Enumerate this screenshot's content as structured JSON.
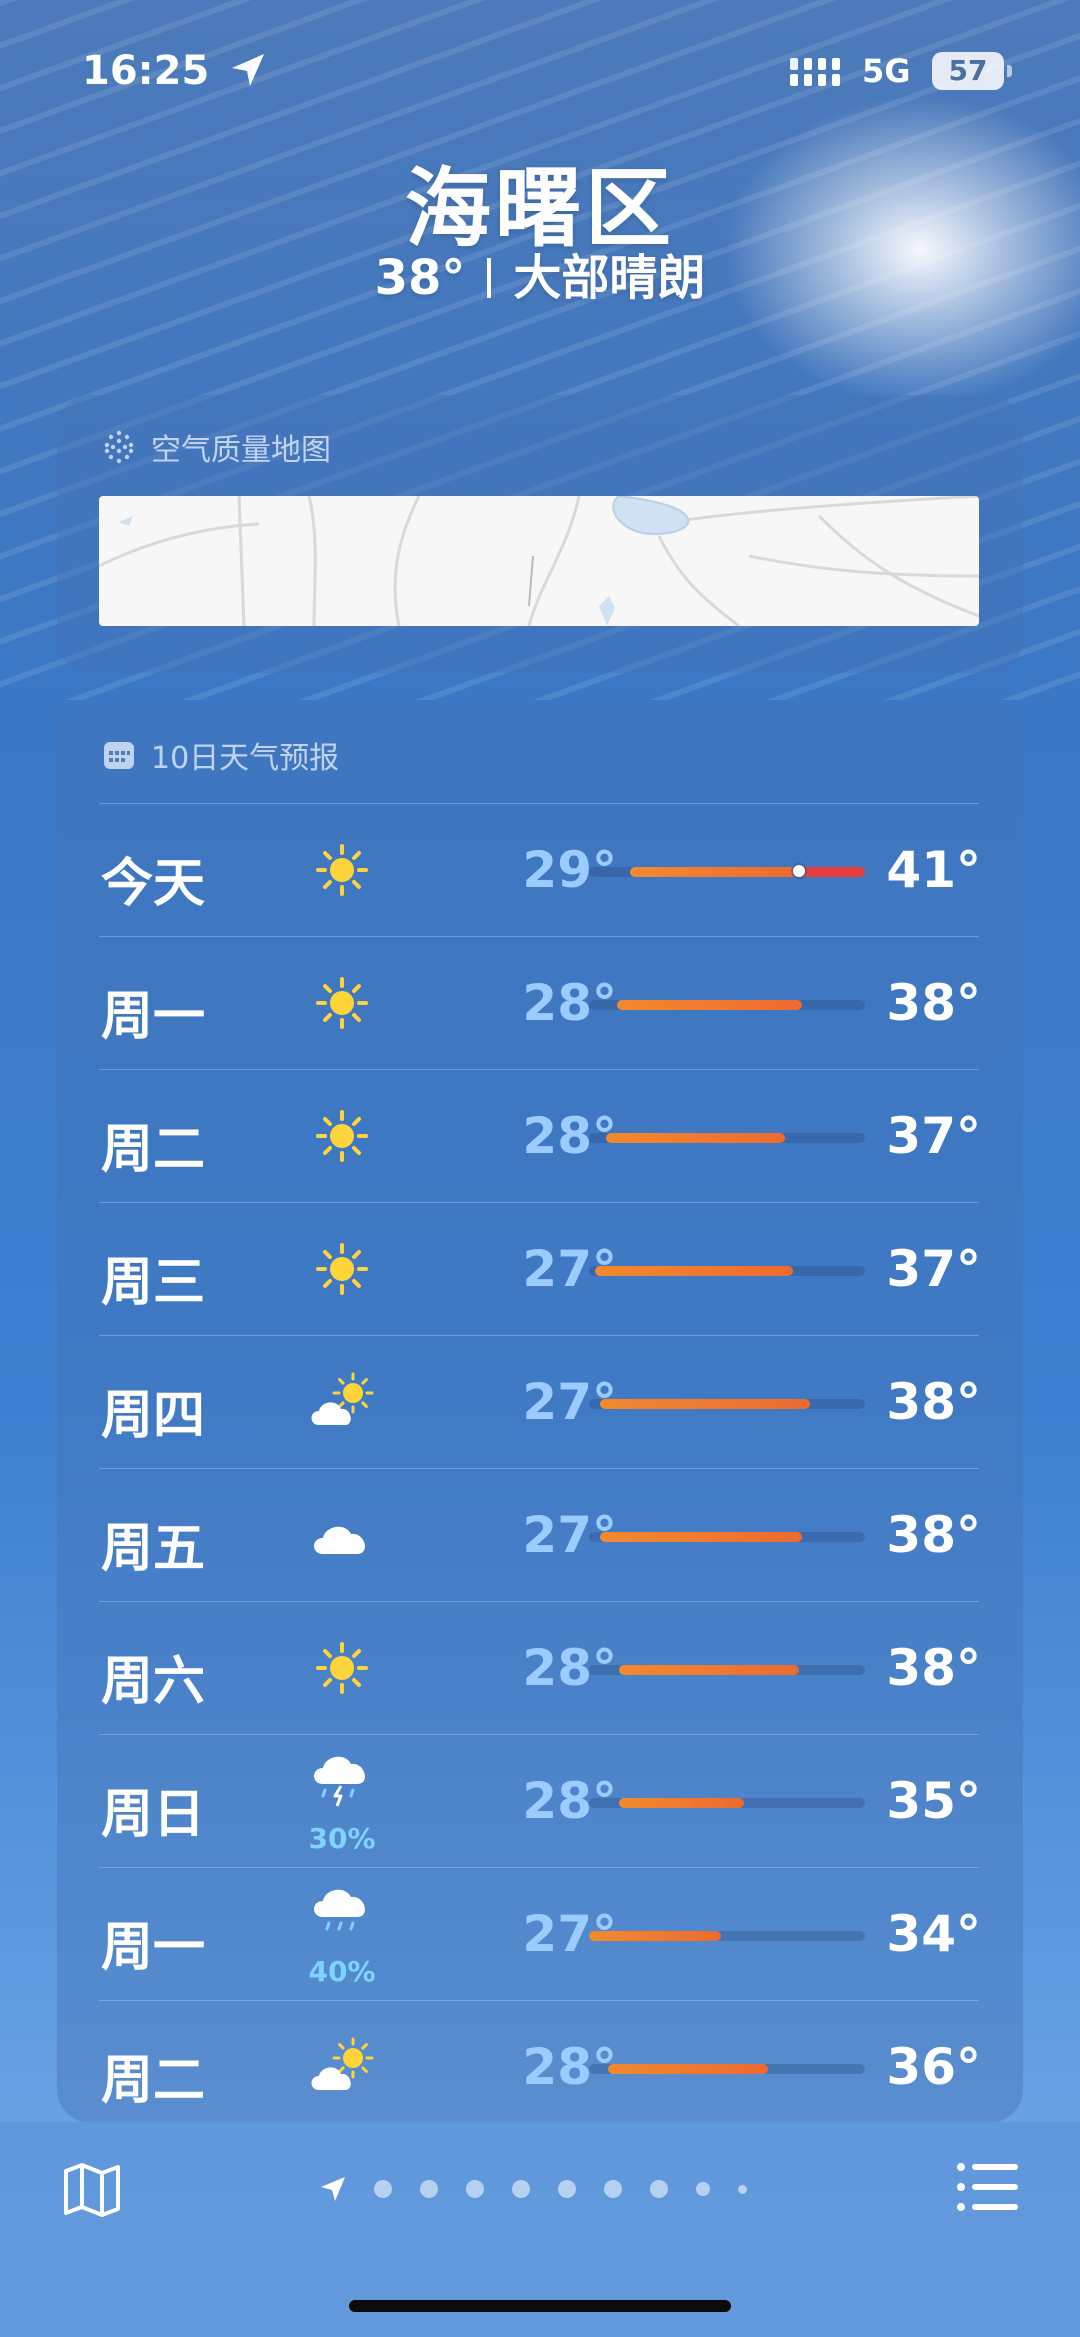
{
  "status_bar": {
    "time": "16:25",
    "network": "5G",
    "battery": "57"
  },
  "location": {
    "city": "海曙区",
    "temperature": "38°",
    "condition": "大部晴朗"
  },
  "air_quality": {
    "title": "空气质量地图",
    "icon": "air-quality-dots-icon"
  },
  "forecast": {
    "title": "10日天气预报",
    "icon": "calendar-icon",
    "days": [
      {
        "day": "今天",
        "icon": "sun-icon",
        "low": "29°",
        "high": "41°",
        "range": [
          0.15,
          1.0
        ],
        "current": 0.76,
        "precip": ""
      },
      {
        "day": "周一",
        "icon": "sun-icon",
        "low": "28°",
        "high": "38°",
        "range": [
          0.1,
          0.77
        ],
        "precip": ""
      },
      {
        "day": "周二",
        "icon": "sun-icon",
        "low": "28°",
        "high": "37°",
        "range": [
          0.06,
          0.71
        ],
        "precip": ""
      },
      {
        "day": "周三",
        "icon": "sun-icon",
        "low": "27°",
        "high": "37°",
        "range": [
          0.02,
          0.74
        ],
        "precip": ""
      },
      {
        "day": "周四",
        "icon": "partly-cloudy-icon",
        "low": "27°",
        "high": "38°",
        "range": [
          0.04,
          0.8
        ],
        "precip": ""
      },
      {
        "day": "周五",
        "icon": "cloud-icon",
        "low": "27°",
        "high": "38°",
        "range": [
          0.04,
          0.77
        ],
        "precip": ""
      },
      {
        "day": "周六",
        "icon": "sun-icon",
        "low": "28°",
        "high": "38°",
        "range": [
          0.11,
          0.76
        ],
        "precip": ""
      },
      {
        "day": "周日",
        "icon": "thunderstorm-icon",
        "low": "28°",
        "high": "35°",
        "range": [
          0.11,
          0.56
        ],
        "precip": "30%"
      },
      {
        "day": "周一",
        "icon": "rain-cloud-icon",
        "low": "27°",
        "high": "34°",
        "range": [
          0.0,
          0.48
        ],
        "precip": "40%"
      },
      {
        "day": "周二",
        "icon": "partly-cloudy-icon",
        "low": "28°",
        "high": "36°",
        "range": [
          0.07,
          0.65
        ],
        "precip": ""
      }
    ]
  },
  "bottom_bar": {
    "page_count": 9,
    "active_page": 0
  },
  "colors": {
    "bar_start": "#f28a2e",
    "bar_end": "#ee6a30",
    "bar_hot": "#e53c3c",
    "low_temp": "#9ccbff",
    "precip": "#7fd3ff",
    "sun": "#ffd43b"
  }
}
